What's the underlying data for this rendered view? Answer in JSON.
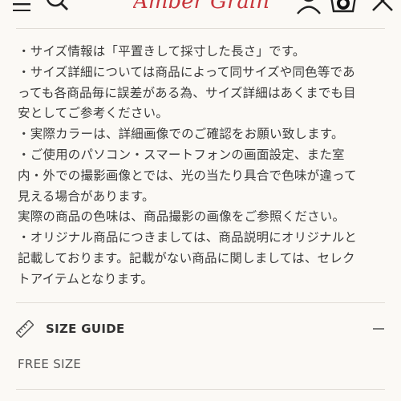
{
  "header": {
    "logo_text": "Amber Grain"
  },
  "notes": {
    "lines": [
      "・サイズ情報は「平置きして採寸した長さ」です。",
      "・サイズ詳細については商品によって同サイズや同色等であ",
      "っても各商品毎に誤差がある為、サイズ詳細はあくまでも目",
      "安としてご参考ください。",
      "・実際カラーは、詳細画像でのご確認をお願い致します。",
      "・ご使用のパソコン・スマートフォンの画面設定、また室",
      "内・外での撮影画像とでは、光の当たり具合で色味が違って",
      "見える場合があります。",
      "実際の商品の色味は、商品撮影の画像をご参照ください。",
      "・オリジナル商品につきましては、商品説明にオリジナルと",
      "記載しております。記載がない商品に関しましては、セレク",
      "トアイテムとなります。"
    ]
  },
  "size_guide": {
    "title": "SIZE GUIDE",
    "value": "FREE SIZE"
  },
  "colors": {
    "background": "#fbf9f5",
    "text": "#333333",
    "logo": "#c8353b",
    "divider": "#e0dcd6"
  }
}
